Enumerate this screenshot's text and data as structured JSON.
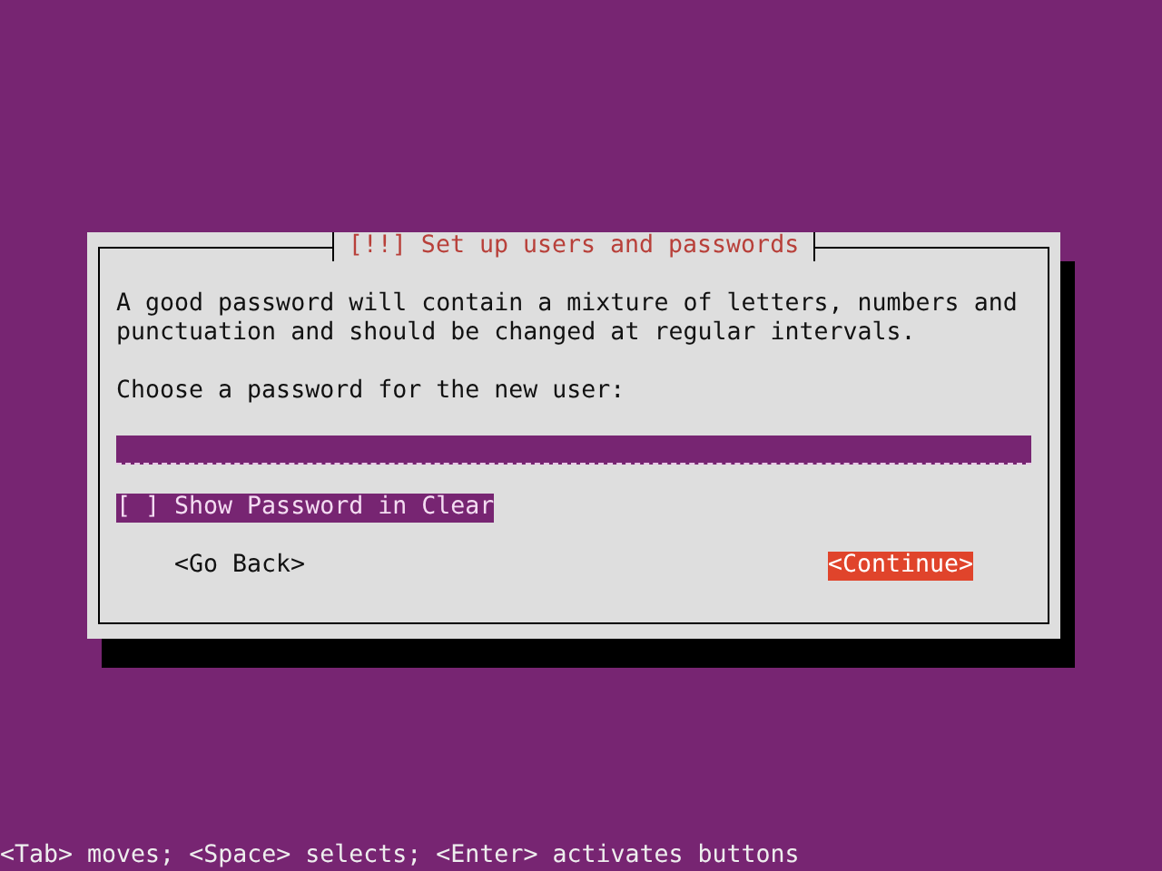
{
  "dialog": {
    "title": "[!!] Set up users and passwords",
    "intro": "A good password will contain a mixture of letters, numbers and punctuation and should be changed at regular intervals.",
    "prompt": "Choose a password for the new user:",
    "password_field": {
      "focused": false
    },
    "checkbox": {
      "mark": "[ ]",
      "label": "Show Password in Clear",
      "focused": true
    },
    "buttons": [
      {
        "label": "<Go Back>",
        "selected": false
      },
      {
        "label": "<Continue>",
        "selected": true
      }
    ]
  },
  "help_line": "<Tab> moves; <Space> selects; <Enter> activates buttons"
}
